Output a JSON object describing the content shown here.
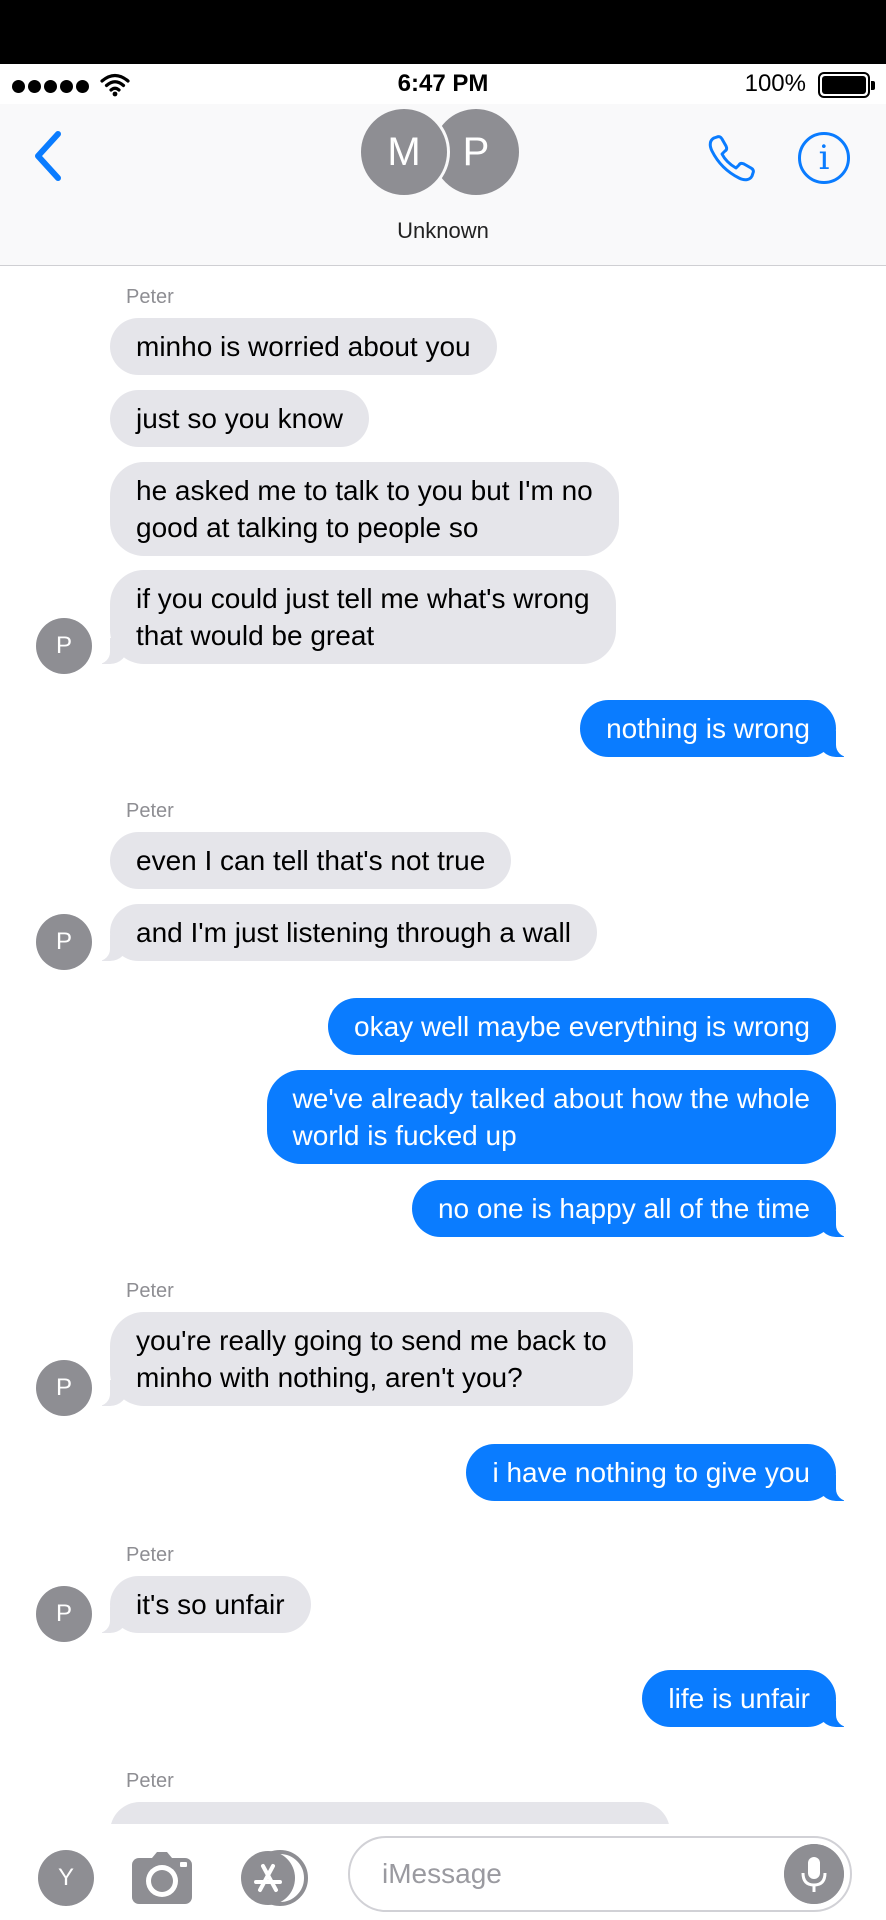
{
  "status_bar": {
    "time": "6:47 PM",
    "battery_percent": "100%"
  },
  "header": {
    "avatars": [
      "M",
      "P"
    ],
    "contact_name": "Unknown"
  },
  "messages": [
    {
      "sender_label": "Peter"
    },
    {
      "text": "minho is worried about you"
    },
    {
      "text": "just so you know"
    },
    {
      "text": "he asked me to talk to you but I'm no\ngood at talking to people so"
    },
    {
      "text": "if you could just tell me what's wrong\nthat would be great",
      "avatar": "P"
    },
    {
      "text": "nothing is wrong"
    },
    {
      "sender_label": "Peter"
    },
    {
      "text": "even I can tell that's not true"
    },
    {
      "text": "and I'm just listening through a wall",
      "avatar": "P"
    },
    {
      "text": "okay well maybe everything is wrong"
    },
    {
      "text": "we've already talked about how the whole\nworld is fucked up"
    },
    {
      "text": "no one is happy all of the time"
    },
    {
      "sender_label": "Peter"
    },
    {
      "text": "you're really going to send me back to\nminho with nothing, aren't you?",
      "avatar": "P"
    },
    {
      "text": "i have nothing to give you"
    },
    {
      "sender_label": "Peter"
    },
    {
      "text": "it's so unfair",
      "avatar": "P"
    },
    {
      "text": "life is unfair"
    },
    {
      "sender_label": "Peter"
    }
  ],
  "toolbar": {
    "account_initial": "Y",
    "input_placeholder": "iMessage"
  },
  "colors": {
    "outgoing": "#0a7cff",
    "incoming": "#e5e5ea",
    "avatar": "#8e8e93",
    "accent": "#0a7cff"
  }
}
